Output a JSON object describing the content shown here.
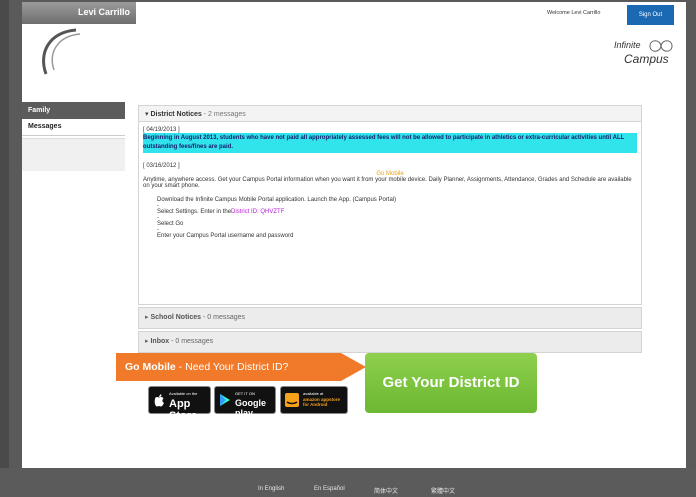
{
  "user": {
    "name": "Levi Carrillo",
    "welcome": "Welcome Levi Carrillo",
    "signout_label": "Sign Out"
  },
  "brand": {
    "line1": "Infinite",
    "line2": "Campus"
  },
  "sidebar": {
    "items": [
      {
        "label": "Family"
      },
      {
        "label": "Messages"
      }
    ]
  },
  "district_notices": {
    "title": "District Notices",
    "count": "- 2 messages",
    "notice1": {
      "date": "[ 04/19/2013 ]",
      "text": "Beginning in August 2013, students who have not paid all appropriately assessed fees will not be allowed to participate in athletics or extra-curricular activities until ALL outstanding fees/fines are paid."
    },
    "notice2": {
      "date": "[ 03/16/2012 ]",
      "heading": "Go Mobile",
      "intro": "Anytime, anywhere access. Get your Campus Portal information when you want it from your mobile device. Daily Planner, Assignments, Attendance, Grades and Schedule are available on your smart phone.",
      "step1": "Download the Infinite Campus Mobile Portal application.  Launch the App. (Campus Portal)",
      "dash": "-",
      "step2_prefix": "Select Settings. Enter in the",
      "district_id": "District ID: QHVZTF",
      "step3": "Select Go",
      "step4": "Enter your Campus Portal username and password"
    }
  },
  "school_notices": {
    "title": "School Notices",
    "count": "- 0 messages"
  },
  "inbox": {
    "title": "Inbox",
    "count": "- 0 messages"
  },
  "promo": {
    "go_mobile": "Go Mobile",
    "need_id": " - Need Your District ID?",
    "get_id_button": "Get Your District ID",
    "appstore": {
      "small": "Available on the",
      "big": "App Store"
    },
    "googleplay": {
      "small": "GET IT ON",
      "big": "Google play"
    },
    "amazon": {
      "small": "available at",
      "big": "amazon appstore for Android"
    }
  },
  "languages": [
    "In English",
    "En Español",
    "简体中文",
    "繁體中文"
  ],
  "colors": {
    "accent_blue": "#1b69b3",
    "highlight": "#31e3eb",
    "orange": "#f07a2a",
    "green": "#7cc441"
  }
}
